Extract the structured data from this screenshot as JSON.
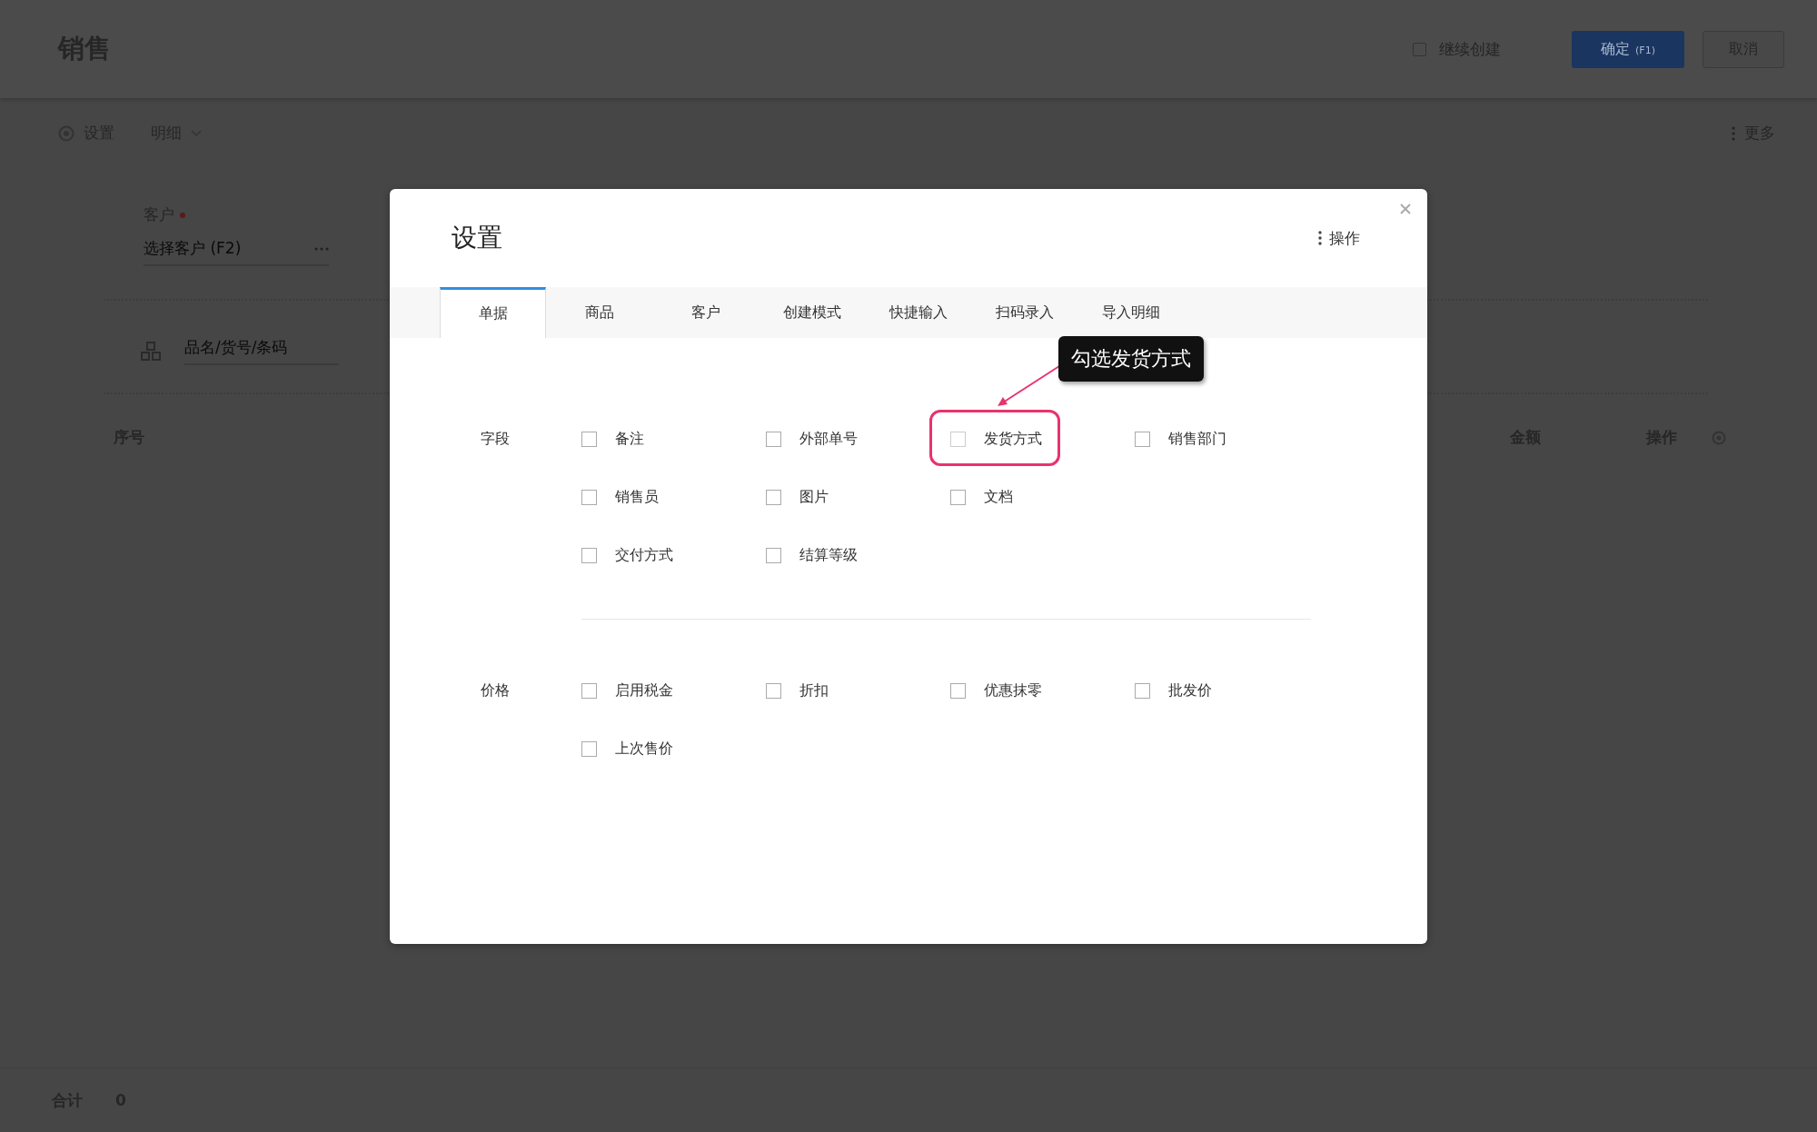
{
  "page": {
    "title": "销售",
    "continue_create": {
      "label": "继续创建",
      "checked": false
    },
    "confirm_button": "确定",
    "confirm_shortcut": "(F1)",
    "cancel_button": "取消",
    "toolbar": {
      "settings": "设置",
      "detail": "明细",
      "more": "更多"
    },
    "customer": {
      "label": "客户",
      "placeholder": "选择客户 (F2)"
    },
    "product_search": {
      "placeholder": "品名/货号/条码"
    },
    "table": {
      "columns": [
        "序号",
        "金额",
        "操作"
      ]
    },
    "footer": {
      "label": "合计",
      "value": "0"
    }
  },
  "dialog": {
    "title": "设置",
    "menu": "操作",
    "tabs": [
      {
        "label": "单据",
        "selected": true
      },
      {
        "label": "商品",
        "selected": false
      },
      {
        "label": "客户",
        "selected": false
      },
      {
        "label": "创建模式",
        "selected": false
      },
      {
        "label": "快捷输入",
        "selected": false
      },
      {
        "label": "扫码录入",
        "selected": false
      },
      {
        "label": "导入明细",
        "selected": false
      }
    ],
    "sections": [
      {
        "label": "字段",
        "rows": [
          [
            {
              "label": "备注",
              "checked": false,
              "highlighted": false
            },
            {
              "label": "外部单号",
              "checked": false,
              "highlighted": false
            },
            {
              "label": "发货方式",
              "checked": false,
              "highlighted": true
            },
            {
              "label": "销售部门",
              "checked": false,
              "highlighted": false
            }
          ],
          [
            {
              "label": "销售员",
              "checked": false,
              "highlighted": false
            },
            {
              "label": "图片",
              "checked": false,
              "highlighted": false
            },
            {
              "label": "文档",
              "checked": false,
              "highlighted": false
            }
          ],
          [
            {
              "label": "交付方式",
              "checked": false,
              "highlighted": false
            },
            {
              "label": "结算等级",
              "checked": false,
              "highlighted": false
            }
          ]
        ]
      },
      {
        "label": "价格",
        "rows": [
          [
            {
              "label": "启用税金",
              "checked": false,
              "highlighted": false
            },
            {
              "label": "折扣",
              "checked": false,
              "highlighted": false
            },
            {
              "label": "优惠抹零",
              "checked": false,
              "highlighted": false
            },
            {
              "label": "批发价",
              "checked": false,
              "highlighted": false
            }
          ],
          [
            {
              "label": "上次售价",
              "checked": false,
              "highlighted": false
            }
          ]
        ]
      }
    ],
    "callout": "勾选发货方式"
  }
}
